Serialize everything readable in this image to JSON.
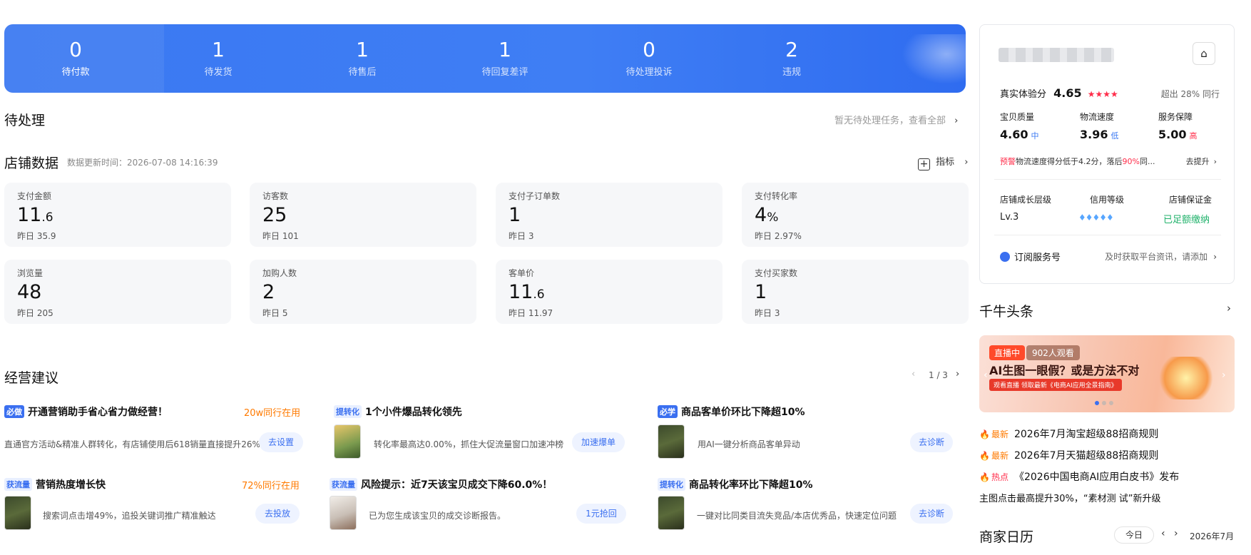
{
  "banner": {
    "stats": [
      {
        "value": "0",
        "label": "待付款"
      },
      {
        "value": "1",
        "label": "待发货"
      },
      {
        "value": "1",
        "label": "待售后"
      },
      {
        "value": "1",
        "label": "待回复差评"
      },
      {
        "value": "0",
        "label": "待处理投诉"
      },
      {
        "value": "2",
        "label": "违规"
      }
    ]
  },
  "pending": {
    "title": "待处理",
    "link": "暂无待处理任务，查看全部"
  },
  "store_data": {
    "title": "店铺数据",
    "update_time": "数据更新时间：2026-07-08 14:16:39",
    "indicator_label": "指标",
    "cards": [
      {
        "title": "支付金额",
        "value_main": "11",
        "value_small": ".6",
        "yesterday": "昨日 35.9"
      },
      {
        "title": "访客数",
        "value_main": "25",
        "value_small": "",
        "yesterday": "昨日 101"
      },
      {
        "title": "支付子订单数",
        "value_main": "1",
        "value_small": "",
        "yesterday": "昨日 3"
      },
      {
        "title": "支付转化率",
        "value_main": "4",
        "value_small": "%",
        "yesterday": "昨日 2.97%"
      },
      {
        "title": "浏览量",
        "value_main": "48",
        "value_small": "",
        "yesterday": "昨日 205"
      },
      {
        "title": "加购人数",
        "value_main": "2",
        "value_small": "",
        "yesterday": "昨日 5"
      },
      {
        "title": "客单价",
        "value_main": "11",
        "value_small": ".6",
        "yesterday": "昨日 11.97"
      },
      {
        "title": "支付买家数",
        "value_main": "1",
        "value_small": "",
        "yesterday": "昨日 3"
      }
    ]
  },
  "suggestions": {
    "title": "经营建议",
    "pager": "1 / 3",
    "items": [
      {
        "tag": "必做",
        "tag_style": "solid",
        "title": "开通营销助手省心省力做经营！",
        "hot": "20w同行在用",
        "desc": "直通官方活动&精准人群转化，有店铺使用后618销量直接提升26%",
        "action": "去设置"
      },
      {
        "tag": "提转化",
        "tag_style": "light",
        "title": "1个小件爆品转化领先",
        "hot": "",
        "desc": "转化率最高达0.00%，抓住大促流量窗口加速冲榜",
        "action": "加速爆单"
      },
      {
        "tag": "必学",
        "tag_style": "solid",
        "title": "商品客单价环比下降超10%",
        "hot": "",
        "desc": "用AI一键分析商品客单异动",
        "action": "去诊断"
      },
      {
        "tag": "获流量",
        "tag_style": "light",
        "title": "营销热度增长快",
        "hot": "72%同行在用",
        "desc": "搜索词点击增49%，追投关键词推广精准触达",
        "action": "去投放"
      },
      {
        "tag": "获流量",
        "tag_style": "light",
        "title": "风险提示：近7天该宝贝成交下降60.0%！",
        "hot": "",
        "desc": "已为您生成该宝贝的成交诊断报告。",
        "action": "1元抢回"
      },
      {
        "tag": "提转化",
        "tag_style": "light",
        "title": "商品转化率环比下降超10%",
        "hot": "",
        "desc": "一键对比同类目流失竞品/本店优秀品，快速定位问题",
        "action": "去诊断"
      }
    ]
  },
  "shop_panel": {
    "experience_label": "真实体验分",
    "experience_score": "4.65",
    "stars": "★★★★",
    "exceed": "超出 28% 同行",
    "metrics": [
      {
        "label": "宝贝质量",
        "value": "4.60",
        "level": "中"
      },
      {
        "label": "物流速度",
        "value": "3.96",
        "level": "低"
      },
      {
        "label": "服务保障",
        "value": "5.00",
        "level": "高"
      }
    ],
    "warning_tag": "预警",
    "warning_text_a": "物流速度得分低于4.2分，落后",
    "warning_pct": "90%",
    "warning_text_b": "同...",
    "warning_action": "去提升",
    "growth_label": "店铺成长层级",
    "growth_value": "Lv.3",
    "credit_label": "信用等级",
    "deposit_label": "店铺保证金",
    "deposit_value": "已足额缴纳",
    "subscribe_label": "订阅服务号",
    "subscribe_desc": "及时获取平台资讯，请添加"
  },
  "qianniu": {
    "title": "千牛头条",
    "live_tag": "直播中",
    "viewers": "902人观看",
    "banner_headline": "AI生图一眼假？或是方法不对",
    "banner_sub": "观看直播  领取最新《电商AI应用全景指南》",
    "news": [
      {
        "tag": "最新",
        "text": "2026年7月淘宝超级88招商规则"
      },
      {
        "tag": "最新",
        "text": "2026年7月天猫超级88招商规则"
      },
      {
        "tag": "热点",
        "text": "《2026中国电商AI应用白皮书》发布"
      },
      {
        "tag": "",
        "text": "主图点击最高提升30%，“素材测 试”新升级"
      }
    ]
  },
  "calendar": {
    "title": "商家日历",
    "today": "今日",
    "month": "2026年7月"
  },
  "colors": {
    "primary": "#3a78f2",
    "orange": "#ff7a00",
    "red": "#ff2d4a",
    "green": "#20b26b",
    "star": "#ff2d4a"
  }
}
